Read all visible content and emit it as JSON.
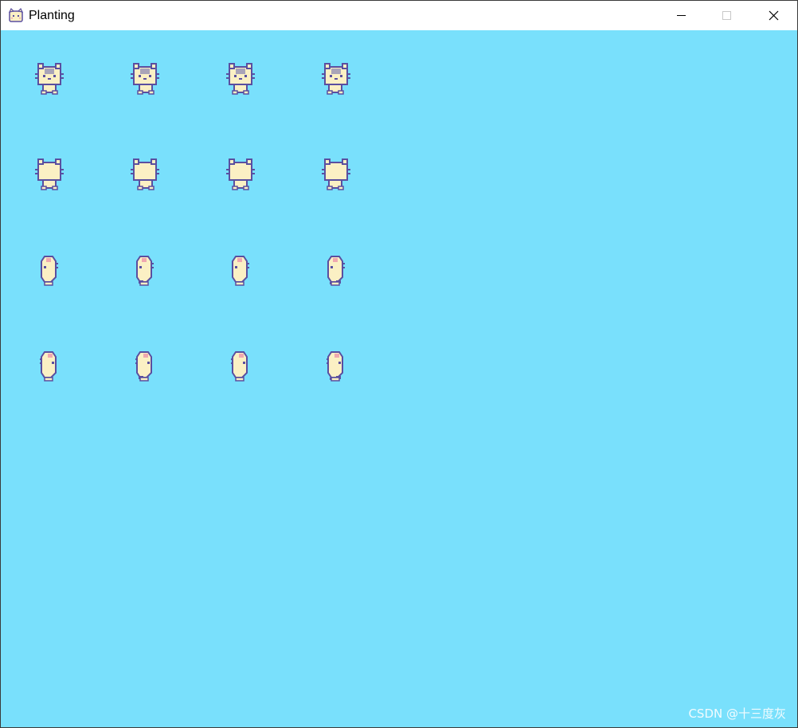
{
  "window": {
    "title": "Planting",
    "icon": "cat-face-icon",
    "controls": {
      "minimize_icon": "minimize-icon",
      "maximize_icon": "maximize-icon",
      "close_icon": "close-icon"
    }
  },
  "canvas": {
    "background_color": "#79e0fc",
    "sprite_colors": {
      "body": "#fbf0c4",
      "outline": "#5a4fa0",
      "accent": "#a9a4b8",
      "cheek": "#f0a8b0"
    },
    "sprite_rows": [
      {
        "direction": "down",
        "frames": [
          1,
          2,
          3,
          4
        ]
      },
      {
        "direction": "up",
        "frames": [
          1,
          2,
          3,
          4
        ]
      },
      {
        "direction": "left",
        "frames": [
          1,
          2,
          3,
          4
        ]
      },
      {
        "direction": "right",
        "frames": [
          1,
          2,
          3,
          4
        ]
      }
    ]
  },
  "watermark": "CSDN @十三度灰"
}
